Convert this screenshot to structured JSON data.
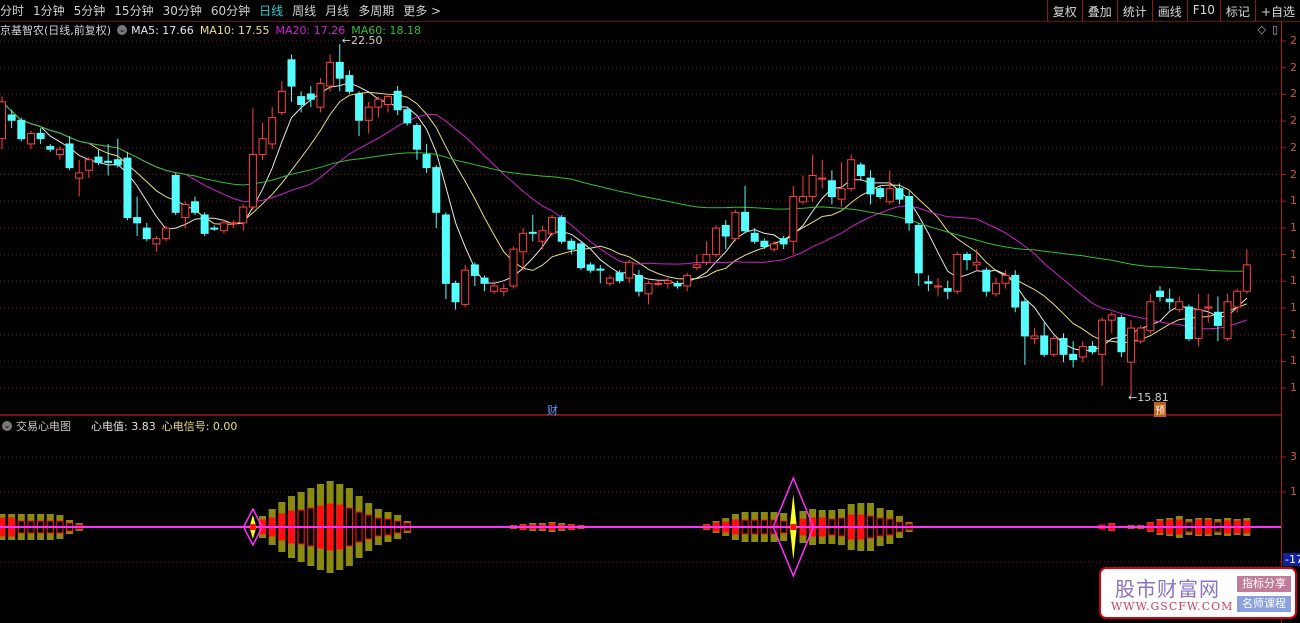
{
  "topbar": {
    "tabs": [
      {
        "label": "分时",
        "active": false
      },
      {
        "label": "1分钟",
        "active": false
      },
      {
        "label": "5分钟",
        "active": false
      },
      {
        "label": "15分钟",
        "active": false
      },
      {
        "label": "30分钟",
        "active": false
      },
      {
        "label": "60分钟",
        "active": false
      },
      {
        "label": "日线",
        "active": true
      },
      {
        "label": "周线",
        "active": false
      },
      {
        "label": "月线",
        "active": false
      },
      {
        "label": "多周期",
        "active": false
      },
      {
        "label": "更多 >",
        "active": false
      }
    ],
    "tools": [
      "复权",
      "叠加",
      "统计",
      "画线",
      "F10",
      "标记",
      "+自选"
    ]
  },
  "legend": {
    "title": "京基智农(日线,前复权)",
    "ma5": "MA5: 17.66",
    "ma10": "MA10: 17.55",
    "ma20": "MA20: 17.26",
    "ma60": "MA60: 18.18"
  },
  "colors": {
    "up": "#ff4040",
    "down": "#54fcfc",
    "ma5": "#e6e6e6",
    "ma10": "#e8e07a",
    "ma20": "#d020d0",
    "ma60": "#30c030",
    "olive": "#8a8a10",
    "red": "#ff1010",
    "signal": "#ff30ff",
    "diamond": "#ffff20"
  },
  "icons": {
    "diamond": "◇",
    "panel": "▯"
  },
  "axis": {
    "main_labels": [
      "2",
      "2",
      "2",
      "2",
      "2",
      "2",
      "1",
      "1",
      "1",
      "1",
      "1",
      "1",
      "1",
      "1"
    ],
    "sub_labels": [
      "3",
      "1"
    ],
    "sub_current": "-17."
  },
  "markers": {
    "high": "22.50",
    "low": "15.81",
    "cai": "财",
    "yu": "预"
  },
  "indicator": {
    "name": "交易心电图",
    "value": "心电值: 3.83",
    "signal": "心电信号: 0.00"
  },
  "watermark": {
    "title": "股市财富网",
    "url": "WWW.GSCFW.COM",
    "tag1": "指标分享",
    "tag2": "名师课程"
  },
  "chart_data": {
    "type": "candlestick",
    "price_range": [
      15.8,
      22.6
    ],
    "ohlc": [
      [
        20.7,
        21.5,
        20.5,
        21.4
      ],
      [
        21.15,
        21.25,
        20.9,
        21.05
      ],
      [
        21.05,
        21.1,
        20.65,
        20.7
      ],
      [
        20.6,
        20.85,
        20.5,
        20.8
      ],
      [
        20.8,
        20.9,
        20.6,
        20.7
      ],
      [
        20.55,
        20.6,
        20.45,
        20.5
      ],
      [
        20.4,
        20.55,
        20.3,
        20.5
      ],
      [
        20.6,
        20.75,
        20.1,
        20.15
      ],
      [
        19.95,
        20.3,
        19.6,
        20.05
      ],
      [
        20.1,
        20.35,
        19.95,
        20.3
      ],
      [
        20.35,
        20.5,
        20.2,
        20.25
      ],
      [
        20.27,
        20.6,
        20.0,
        20.25
      ],
      [
        20.3,
        20.7,
        20.15,
        20.2
      ],
      [
        20.33,
        20.45,
        19.15,
        19.2
      ],
      [
        19.2,
        19.6,
        18.85,
        19.1
      ],
      [
        19.0,
        19.1,
        18.75,
        18.8
      ],
      [
        18.7,
        18.85,
        18.55,
        18.8
      ],
      [
        18.8,
        19.05,
        18.75,
        19.0
      ],
      [
        20.0,
        20.05,
        19.25,
        19.3
      ],
      [
        19.2,
        19.5,
        19.0,
        19.45
      ],
      [
        19.5,
        19.6,
        19.25,
        19.3
      ],
      [
        19.25,
        19.3,
        18.85,
        18.9
      ],
      [
        19.0,
        19.05,
        18.95,
        18.98
      ],
      [
        18.95,
        19.15,
        18.9,
        19.1
      ],
      [
        19.08,
        19.15,
        19.0,
        19.1
      ],
      [
        19.1,
        19.45,
        18.95,
        19.4
      ],
      [
        19.4,
        21.28,
        19.35,
        20.4
      ],
      [
        20.4,
        21.0,
        20.3,
        20.7
      ],
      [
        20.6,
        21.3,
        20.5,
        21.1
      ],
      [
        21.2,
        21.8,
        21.15,
        21.6
      ],
      [
        22.2,
        22.3,
        21.4,
        21.7
      ],
      [
        21.5,
        21.6,
        21.2,
        21.35
      ],
      [
        21.55,
        21.7,
        21.3,
        21.45
      ],
      [
        21.3,
        21.85,
        21.2,
        21.75
      ],
      [
        21.7,
        22.3,
        21.6,
        22.15
      ],
      [
        22.15,
        22.5,
        21.6,
        21.85
      ],
      [
        21.9,
        22.0,
        21.55,
        21.6
      ],
      [
        21.55,
        21.6,
        20.75,
        21.05
      ],
      [
        21.05,
        21.4,
        20.8,
        21.3
      ],
      [
        21.3,
        21.5,
        21.1,
        21.45
      ],
      [
        21.35,
        21.55,
        21.2,
        21.5
      ],
      [
        21.6,
        21.7,
        21.15,
        21.25
      ],
      [
        21.25,
        21.3,
        20.95,
        21.0
      ],
      [
        20.95,
        21.0,
        20.3,
        20.5
      ],
      [
        20.4,
        20.6,
        20.05,
        20.15
      ],
      [
        20.15,
        20.2,
        19.0,
        19.3
      ],
      [
        19.25,
        19.3,
        17.65,
        17.95
      ],
      [
        17.95,
        18.0,
        17.45,
        17.6
      ],
      [
        17.55,
        18.3,
        17.5,
        18.2
      ],
      [
        18.3,
        18.35,
        17.9,
        18.1
      ],
      [
        18.05,
        18.1,
        17.8,
        17.95
      ],
      [
        17.8,
        18.0,
        17.75,
        17.9
      ],
      [
        17.8,
        17.95,
        17.7,
        17.85
      ],
      [
        17.9,
        18.65,
        17.85,
        18.6
      ],
      [
        18.55,
        19.0,
        18.2,
        18.9
      ],
      [
        18.92,
        19.25,
        18.75,
        18.9
      ],
      [
        18.75,
        19.05,
        18.6,
        18.95
      ],
      [
        18.9,
        19.25,
        18.85,
        19.2
      ],
      [
        19.2,
        19.25,
        18.7,
        18.75
      ],
      [
        18.75,
        18.8,
        18.5,
        18.6
      ],
      [
        18.7,
        18.75,
        18.2,
        18.25
      ],
      [
        18.3,
        18.35,
        18.15,
        18.2
      ],
      [
        18.22,
        18.3,
        17.95,
        18.2
      ],
      [
        17.95,
        18.1,
        17.9,
        18.05
      ],
      [
        18.15,
        18.2,
        17.95,
        18.0
      ],
      [
        18.05,
        18.4,
        17.95,
        18.35
      ],
      [
        18.1,
        18.2,
        17.7,
        17.8
      ],
      [
        17.75,
        18.0,
        17.55,
        17.95
      ],
      [
        17.95,
        18.0,
        17.9,
        17.95
      ],
      [
        17.95,
        18.05,
        17.85,
        18.0
      ],
      [
        17.95,
        18.0,
        17.85,
        17.9
      ],
      [
        17.9,
        18.15,
        17.8,
        18.1
      ],
      [
        18.25,
        18.5,
        18.2,
        18.3
      ],
      [
        18.35,
        18.75,
        18.3,
        18.5
      ],
      [
        18.5,
        19.05,
        18.45,
        19.0
      ],
      [
        19.05,
        19.15,
        18.6,
        18.85
      ],
      [
        18.8,
        19.35,
        18.75,
        19.3
      ],
      [
        19.3,
        19.8,
        18.9,
        18.95
      ],
      [
        18.9,
        19.0,
        18.7,
        18.75
      ],
      [
        18.75,
        18.8,
        18.6,
        18.65
      ],
      [
        18.6,
        18.75,
        18.55,
        18.7
      ],
      [
        18.8,
        18.85,
        18.6,
        18.7
      ],
      [
        18.75,
        19.8,
        18.5,
        19.6
      ],
      [
        19.5,
        20.0,
        19.45,
        19.6
      ],
      [
        19.6,
        20.4,
        19.5,
        20.0
      ],
      [
        19.95,
        20.3,
        19.75,
        19.95
      ],
      [
        19.9,
        20.1,
        19.45,
        19.6
      ],
      [
        19.55,
        20.25,
        19.4,
        19.75
      ],
      [
        19.75,
        20.4,
        19.7,
        20.3
      ],
      [
        20.2,
        20.25,
        19.9,
        20.0
      ],
      [
        19.95,
        20.1,
        19.45,
        19.65
      ],
      [
        19.75,
        19.8,
        19.55,
        19.6
      ],
      [
        19.5,
        20.1,
        19.45,
        19.75
      ],
      [
        19.75,
        19.85,
        19.45,
        19.55
      ],
      [
        19.6,
        19.7,
        18.95,
        19.1
      ],
      [
        19.05,
        19.1,
        17.9,
        18.15
      ],
      [
        17.98,
        18.1,
        17.8,
        17.95
      ],
      [
        17.9,
        18.05,
        17.7,
        17.9
      ],
      [
        17.85,
        18.0,
        17.65,
        17.8
      ],
      [
        17.8,
        18.55,
        17.75,
        18.5
      ],
      [
        18.5,
        18.55,
        18.2,
        18.4
      ],
      [
        18.3,
        18.6,
        18.2,
        18.35
      ],
      [
        18.2,
        18.25,
        17.7,
        17.8
      ],
      [
        17.75,
        18.05,
        17.7,
        17.95
      ],
      [
        17.95,
        18.2,
        17.85,
        18.1
      ],
      [
        18.1,
        18.2,
        17.4,
        17.5
      ],
      [
        17.6,
        17.65,
        16.4,
        16.95
      ],
      [
        16.9,
        17.1,
        16.8,
        16.95
      ],
      [
        16.95,
        17.2,
        16.55,
        16.6
      ],
      [
        16.6,
        16.95,
        16.55,
        16.9
      ],
      [
        16.9,
        17.0,
        16.45,
        16.6
      ],
      [
        16.6,
        16.85,
        16.35,
        16.5
      ],
      [
        16.55,
        16.85,
        16.45,
        16.75
      ],
      [
        16.75,
        16.85,
        16.6,
        16.65
      ],
      [
        16.6,
        17.3,
        16.0,
        17.25
      ],
      [
        17.25,
        17.4,
        17.0,
        17.35
      ],
      [
        17.3,
        17.35,
        16.55,
        16.65
      ],
      [
        16.45,
        17.25,
        15.81,
        17.1
      ],
      [
        16.85,
        17.15,
        16.8,
        17.1
      ],
      [
        17.05,
        17.75,
        17.0,
        17.6
      ],
      [
        17.8,
        17.9,
        17.6,
        17.7
      ],
      [
        17.65,
        17.85,
        17.45,
        17.6
      ],
      [
        17.45,
        17.7,
        17.4,
        17.6
      ],
      [
        17.5,
        17.55,
        16.85,
        16.9
      ],
      [
        16.9,
        17.75,
        16.75,
        17.45
      ],
      [
        17.48,
        17.75,
        17.2,
        17.5
      ],
      [
        17.4,
        17.7,
        16.85,
        17.15
      ],
      [
        16.9,
        17.75,
        16.85,
        17.6
      ],
      [
        17.5,
        17.85,
        17.4,
        17.8
      ],
      [
        17.8,
        18.6,
        17.75,
        18.3
      ]
    ],
    "ma_periods": [
      5,
      10,
      20,
      60
    ],
    "high_index": 35,
    "low_index": 117,
    "cai_index": 57,
    "yu_index": 120,
    "ecg": [
      {
        "i": 0,
        "o": 6.5,
        "r": 4.5,
        "f": 1
      },
      {
        "i": 1,
        "o": 6.5,
        "r": 4.5,
        "f": 1
      },
      {
        "i": 2,
        "o": 6.5,
        "r": 3,
        "f": 0
      },
      {
        "i": 3,
        "o": 6.5,
        "r": 3,
        "f": 0
      },
      {
        "i": 4,
        "o": 6.5,
        "r": 3,
        "f": 0
      },
      {
        "i": 5,
        "o": 6.5,
        "r": 3,
        "f": 0
      },
      {
        "i": 6,
        "o": 6,
        "r": 3,
        "f": 0
      },
      {
        "i": 7,
        "o": 3.5,
        "r": 2,
        "f": 0
      },
      {
        "i": 8,
        "o": 2,
        "r": 1,
        "f": 0
      },
      {
        "i": 27,
        "o": 5.5,
        "r": 3.5,
        "f": 1
      },
      {
        "i": 28,
        "o": 9,
        "r": 4.5,
        "f": 1
      },
      {
        "i": 29,
        "o": 12.5,
        "r": 6.5,
        "f": 1
      },
      {
        "i": 30,
        "o": 15.5,
        "r": 8,
        "f": 1
      },
      {
        "i": 31,
        "o": 17.5,
        "r": 8.5,
        "f": 0
      },
      {
        "i": 32,
        "o": 19.5,
        "r": 9.5,
        "f": 0
      },
      {
        "i": 33,
        "o": 21.5,
        "r": 10.5,
        "f": 1
      },
      {
        "i": 34,
        "o": 23,
        "r": 11.5,
        "f": 1
      },
      {
        "i": 35,
        "o": 21.5,
        "r": 11,
        "f": 1
      },
      {
        "i": 36,
        "o": 19.5,
        "r": 9.5,
        "f": 0
      },
      {
        "i": 37,
        "o": 15.5,
        "r": 7.5,
        "f": 0
      },
      {
        "i": 38,
        "o": 12,
        "r": 6,
        "f": 0
      },
      {
        "i": 39,
        "o": 9,
        "r": 4.5,
        "f": 0
      },
      {
        "i": 40,
        "o": 7.5,
        "r": 4,
        "f": 0
      },
      {
        "i": 41,
        "o": 6,
        "r": 3,
        "f": 0
      },
      {
        "i": 42,
        "o": 3,
        "r": 2,
        "f": 0
      },
      {
        "i": 53,
        "o": 1,
        "r": 0.5,
        "f": 1
      },
      {
        "i": 54,
        "o": 1.5,
        "r": 1,
        "f": 1
      },
      {
        "i": 55,
        "o": 2,
        "r": 1,
        "f": 1
      },
      {
        "i": 56,
        "o": 2,
        "r": 1,
        "f": 1
      },
      {
        "i": 57,
        "o": 2.5,
        "r": 1.5,
        "f": 1
      },
      {
        "i": 58,
        "o": 2,
        "r": 1,
        "f": 1
      },
      {
        "i": 59,
        "o": 1.5,
        "r": 1,
        "f": 1
      },
      {
        "i": 60,
        "o": 1,
        "r": 0.5,
        "f": 1
      },
      {
        "i": 73,
        "o": 1.5,
        "r": 1,
        "f": 1
      },
      {
        "i": 74,
        "o": 3,
        "r": 2,
        "f": 1
      },
      {
        "i": 75,
        "o": 4.5,
        "r": 2.5,
        "f": 1
      },
      {
        "i": 76,
        "o": 6.5,
        "r": 3.5,
        "f": 1
      },
      {
        "i": 77,
        "o": 7.5,
        "r": 3.5,
        "f": 0
      },
      {
        "i": 78,
        "o": 7.5,
        "r": 3.5,
        "f": 0
      },
      {
        "i": 79,
        "o": 7.5,
        "r": 3.5,
        "f": 0
      },
      {
        "i": 80,
        "o": 7.5,
        "r": 3.5,
        "f": 0
      },
      {
        "i": 81,
        "o": 7,
        "r": 3,
        "f": 0
      },
      {
        "i": 83,
        "o": 8,
        "r": 4,
        "f": 1
      },
      {
        "i": 84,
        "o": 9,
        "r": 4.5,
        "f": 1
      },
      {
        "i": 85,
        "o": 8.5,
        "r": 4.5,
        "f": 1
      },
      {
        "i": 86,
        "o": 8.5,
        "r": 4,
        "f": 0
      },
      {
        "i": 87,
        "o": 9,
        "r": 4.5,
        "f": 0
      },
      {
        "i": 88,
        "o": 11.5,
        "r": 6,
        "f": 1
      },
      {
        "i": 89,
        "o": 12,
        "r": 6,
        "f": 1
      },
      {
        "i": 90,
        "o": 12,
        "r": 5.5,
        "f": 0
      },
      {
        "i": 91,
        "o": 9.5,
        "r": 4.5,
        "f": 0
      },
      {
        "i": 92,
        "o": 8.5,
        "r": 4,
        "f": 0
      },
      {
        "i": 93,
        "o": 5.5,
        "r": 2.5,
        "f": 0
      },
      {
        "i": 94,
        "o": 2.5,
        "r": 1.5,
        "f": 0
      },
      {
        "i": 114,
        "o": 1,
        "r": 1,
        "f": 1
      },
      {
        "i": 115,
        "o": 2,
        "r": 1.5,
        "f": 1
      },
      {
        "i": 117,
        "o": 1,
        "r": 0.5,
        "f": 1
      },
      {
        "i": 118,
        "o": 1,
        "r": 0.5,
        "f": 1
      },
      {
        "i": 119,
        "o": 2.5,
        "r": 2,
        "f": 1
      },
      {
        "i": 120,
        "o": 4,
        "r": 3,
        "f": 1
      },
      {
        "i": 121,
        "o": 4.5,
        "r": 3.5,
        "f": 1
      },
      {
        "i": 122,
        "o": 5.5,
        "r": 3.5,
        "f": 1
      },
      {
        "i": 123,
        "o": 4,
        "r": 2.5,
        "f": 0
      },
      {
        "i": 124,
        "o": 4.5,
        "r": 3.5,
        "f": 1
      },
      {
        "i": 125,
        "o": 4.5,
        "r": 3.5,
        "f": 1
      },
      {
        "i": 126,
        "o": 4,
        "r": 2.5,
        "f": 0
      },
      {
        "i": 127,
        "o": 4.5,
        "r": 3,
        "f": 1
      },
      {
        "i": 128,
        "o": 4,
        "r": 3,
        "f": 1
      },
      {
        "i": 129,
        "o": 4.5,
        "r": 3,
        "f": 1
      }
    ],
    "ecg_signals": [
      {
        "i": 26,
        "outer": 9,
        "inner": 6
      },
      {
        "i": 82,
        "outer": 24.5,
        "inner": 16.5
      }
    ]
  }
}
